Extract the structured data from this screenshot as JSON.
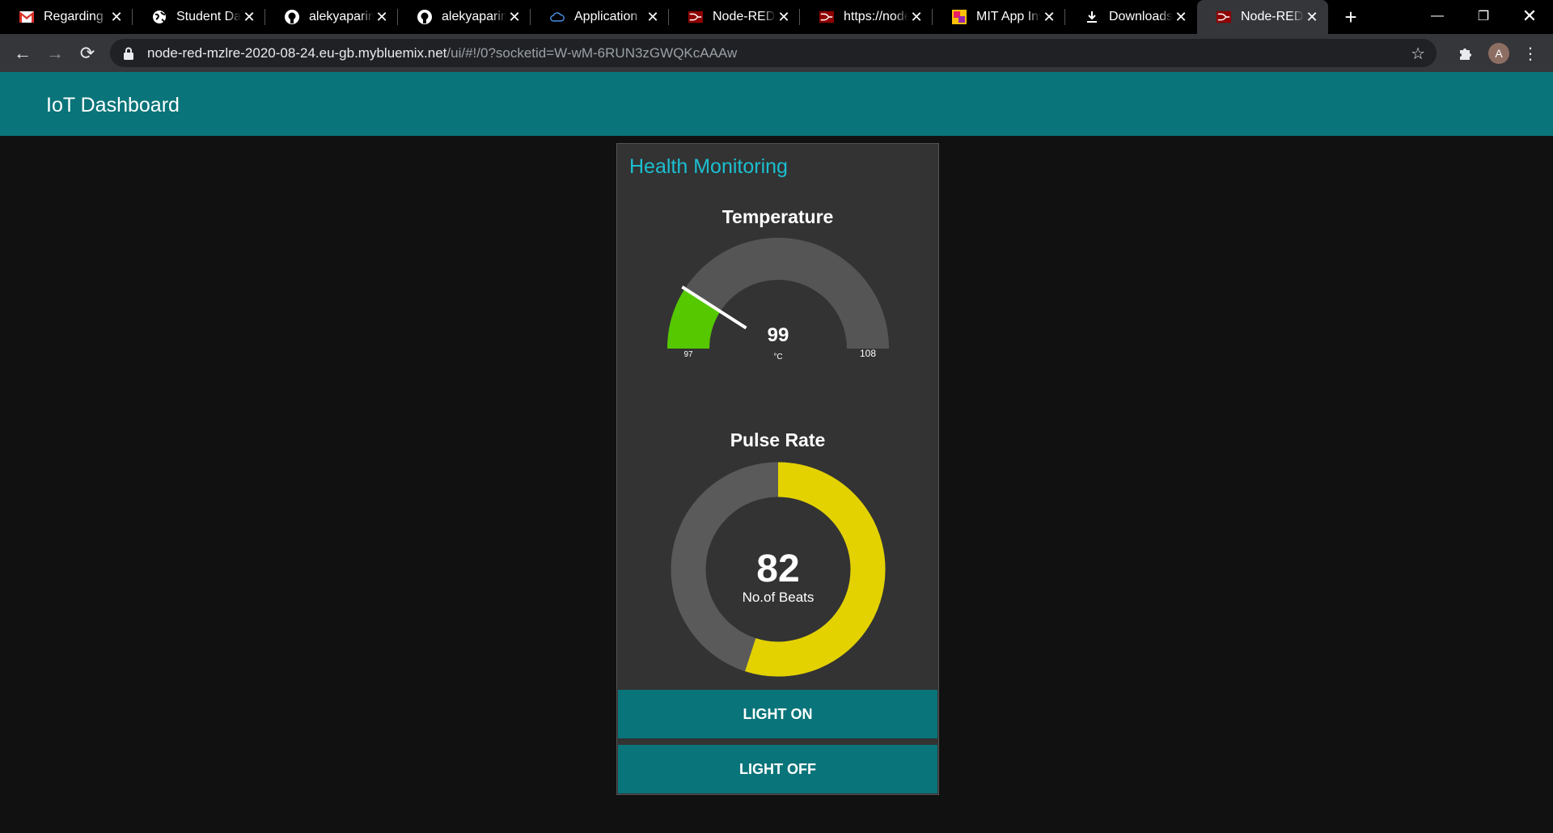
{
  "browser": {
    "tabs": [
      {
        "title": "Regarding sr",
        "icon": "gmail-icon"
      },
      {
        "title": "Student Dash",
        "icon": "globe-icon"
      },
      {
        "title": "alekyaparima",
        "icon": "github-icon"
      },
      {
        "title": "alekyaparima",
        "icon": "github-icon"
      },
      {
        "title": "Application",
        "icon": "cloud-icon"
      },
      {
        "title": "Node-RED :",
        "icon": "node-red-icon"
      },
      {
        "title": "https://node",
        "icon": "node-red-icon"
      },
      {
        "title": "MIT App Inv",
        "icon": "app-inventor-icon"
      },
      {
        "title": "Downloads",
        "icon": "download-icon"
      },
      {
        "title": "Node-RED D",
        "icon": "node-red-icon"
      }
    ],
    "url_host": "node-red-mzlre-2020-08-24.eu-gb.mybluemix.net",
    "url_path": "/ui/#!/0?socketid=W-wM-6RUN3zGWQKcAAAw",
    "profile_initial": "A"
  },
  "dashboard": {
    "title": "IoT Dashboard",
    "group_title": "Health Monitoring",
    "temperature": {
      "label": "Temperature",
      "value": 99,
      "unit": "°C",
      "min": 97,
      "max": 108,
      "segment_color": "#55c800",
      "track_color": "#555555"
    },
    "pulse": {
      "label": "Pulse Rate",
      "value": 82,
      "unit": "No.of Beats",
      "fill_fraction": 0.55,
      "segment_color": "#e3d200",
      "track_color": "#5a5a5a"
    },
    "buttons": {
      "light_on": "LIGHT ON",
      "light_off": "LIGHT OFF"
    },
    "colors": {
      "header_bg": "#097479",
      "group_title": "#1bbfd0",
      "button_bg": "#097479"
    }
  }
}
